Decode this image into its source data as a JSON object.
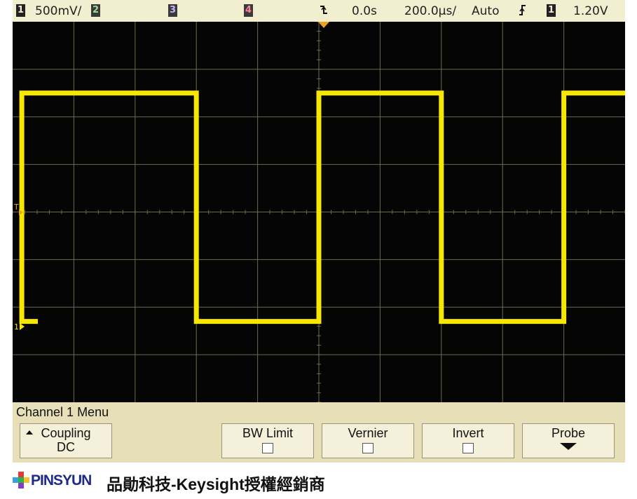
{
  "status": {
    "ch1": {
      "num": "1",
      "scale": "500mV/"
    },
    "ch2": {
      "num": "2"
    },
    "ch3": {
      "num": "3"
    },
    "ch4": {
      "num": "4"
    },
    "trigger_offset": "0.0s",
    "timebase": "200.0µs/",
    "trigger_mode": "Auto",
    "trigger_slope_icon": "rising-edge-icon",
    "trigger_source": "1",
    "trigger_level": "1.20V"
  },
  "markers": {
    "trigger_level": "T",
    "channel1_ground": "1"
  },
  "menu": {
    "title": "Channel 1  Menu",
    "softkeys": [
      {
        "label": "Coupling",
        "value": "DC"
      },
      {
        "label": "BW Limit"
      },
      {
        "label": "Vernier"
      },
      {
        "label": "Invert"
      },
      {
        "label": "Probe"
      }
    ]
  },
  "footer": {
    "brand": "PINSYUN",
    "tagline": "品勛科技-Keysight授權經銷商"
  },
  "colors": {
    "trace": "#f7e600",
    "screen": "#050505",
    "grid": "#6b6b52",
    "bezel": "#e6dfb8",
    "brand": "#1f2b8a"
  },
  "waveform": {
    "type": "square",
    "low_level_div": -2.3,
    "high_level_div": 2.5,
    "transitions_div": [
      -4.85,
      -2.0,
      0.0,
      2.0,
      4.0
    ],
    "x_range_div": [
      -5,
      5
    ]
  }
}
